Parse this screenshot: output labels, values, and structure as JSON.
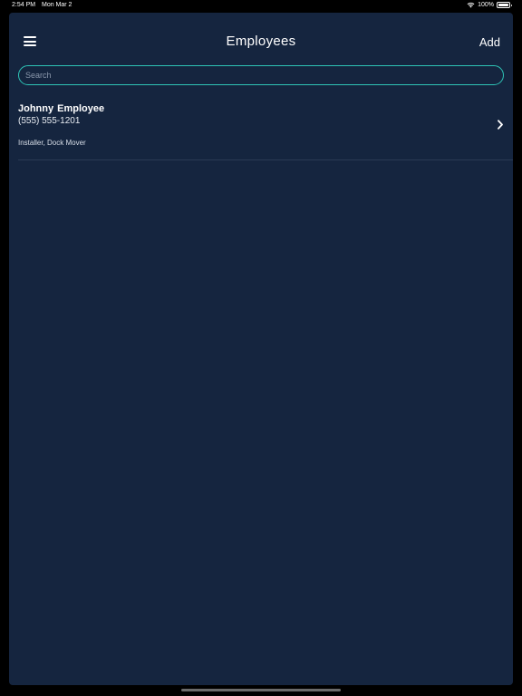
{
  "status_bar": {
    "time": "2:54 PM",
    "date": "Mon Mar 2",
    "battery": "100%",
    "battery_level": 1.0
  },
  "nav": {
    "title": "Employees",
    "add_label": "Add",
    "menu_icon": "hamburger-menu-icon"
  },
  "search": {
    "placeholder": "Search",
    "value": ""
  },
  "employees": [
    {
      "name": "Johnny  Employee",
      "phone": "(555) 555-1201",
      "roles": "Installer, Dock Mover"
    }
  ],
  "colors": {
    "background": "#15253f",
    "accent": "#2ec4b6"
  }
}
